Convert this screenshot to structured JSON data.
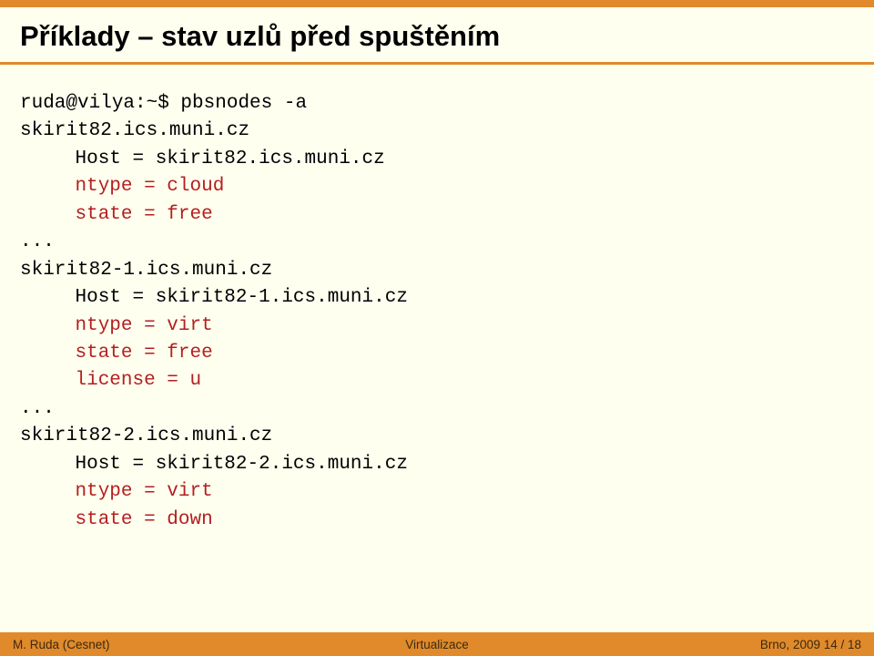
{
  "title": "Příklady – stav uzlů před spuštěním",
  "code": {
    "l0": "ruda@vilya:~$ pbsnodes -a",
    "l1": "skirit82.ics.muni.cz",
    "l2": "Host = skirit82.ics.muni.cz",
    "l3": "ntype = cloud",
    "l4": "state = free",
    "l5": "...",
    "l6": "skirit82-1.ics.muni.cz",
    "l7": "Host = skirit82-1.ics.muni.cz",
    "l8": "ntype = virt",
    "l9": "state = free",
    "l10": "license = u",
    "l11": "...",
    "l12": "skirit82-2.ics.muni.cz",
    "l13": "Host = skirit82-2.ics.muni.cz",
    "l14": "ntype = virt",
    "l15": "state = down"
  },
  "footer": {
    "left": "M. Ruda (Cesnet)",
    "center": "Virtualizace",
    "right": "Brno, 2009      14 / 18"
  }
}
